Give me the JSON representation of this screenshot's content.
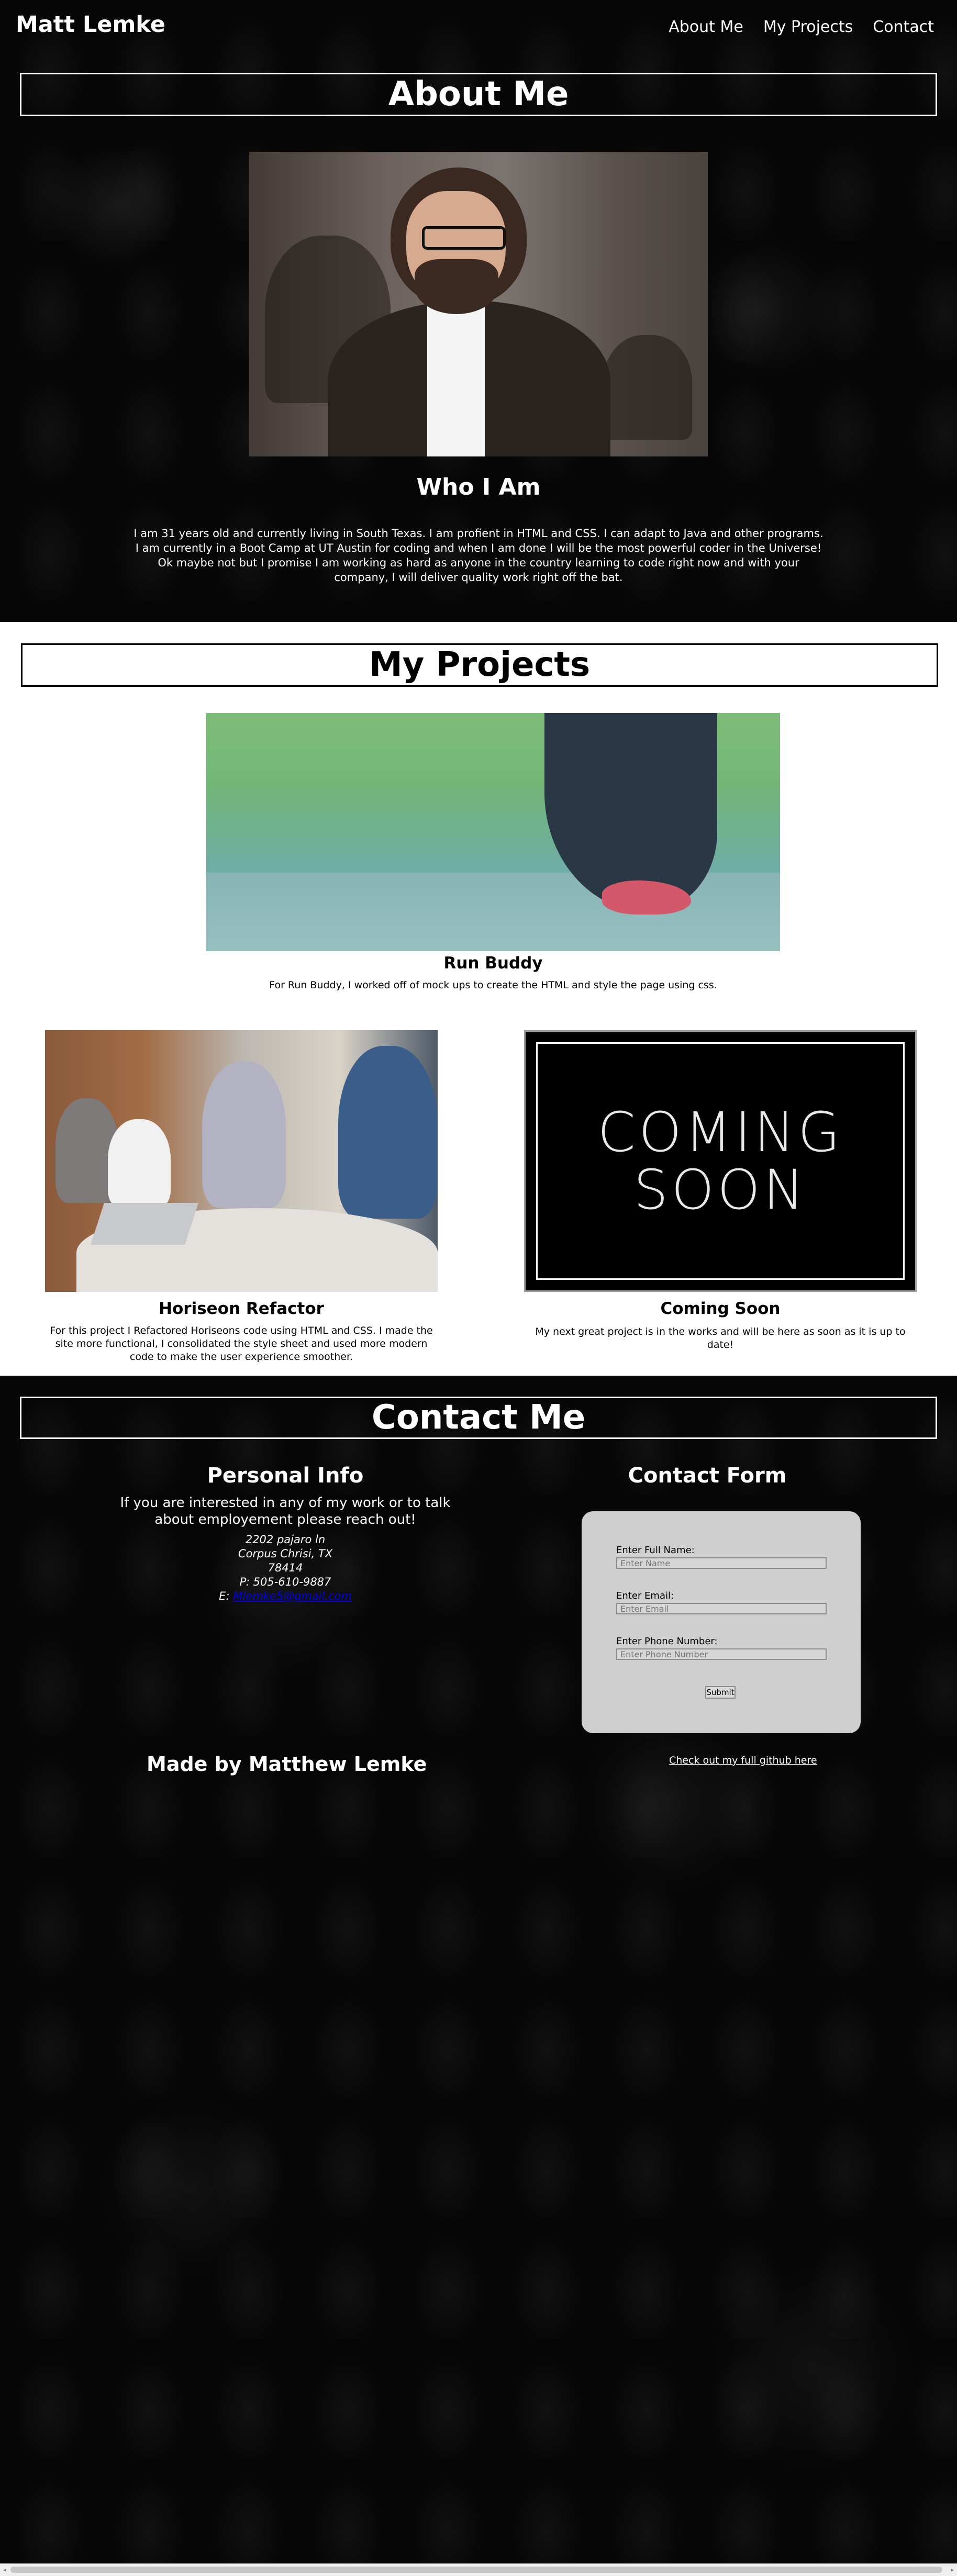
{
  "header": {
    "brand": "Matt Lemke",
    "nav": [
      "About Me",
      "My Projects",
      "Contact"
    ]
  },
  "about": {
    "title": "About Me",
    "photo_alt": "profile photo",
    "who_title": "Who I Am",
    "who_text": "I am 31 years old and currently living in South Texas. I am profient in HTML and CSS. I can adapt to Java and other programs. I am currently in a Boot Camp at UT Austin for coding and when I am done I will be the most powerful coder in the Universe! Ok maybe not but I promise I am working as hard as anyone in the country learning to code right now and with your company, I will deliver quality work right off the bat."
  },
  "projects": {
    "title": "My Projects",
    "run_buddy": {
      "title": "Run Buddy",
      "text": "For Run Buddy, I worked off of mock ups to create the HTML and style the page using css."
    },
    "horiseon": {
      "title": "Horiseon Refactor",
      "text": "For this project I Refactored Horiseons code using HTML and CSS. I made the site more functional, I consolidated the style sheet and used more modern code to make the user experience smoother."
    },
    "coming_soon": {
      "title": "Coming Soon",
      "image_text": [
        "COMING",
        "SOON"
      ],
      "text": "My next great project is in the works and will be here as soon as it is up to date!"
    }
  },
  "contact": {
    "title": "Contact Me",
    "personal_info": {
      "title": "Personal Info",
      "intro": "If you are interested in any of my work or to talk about employement please reach out!",
      "address_line1": "2202 pajaro ln",
      "address_line2": "Corpus Chrisi, TX",
      "address_line3": "78414",
      "phone": "P: 505-610-9887",
      "email_prefix": "E: ",
      "email": "Mlemke5@gmail.com"
    },
    "form": {
      "title": "Contact Form",
      "name_label": "Enter Full Name:",
      "name_placeholder": "Enter Name",
      "email_label": "Enter Email:",
      "email_placeholder": "Enter Email",
      "phone_label": "Enter Phone Number:",
      "phone_placeholder": "Enter Phone Number",
      "submit": "Submit"
    },
    "github_link": "Check out my full github here",
    "made_by": "Made by Matthew Lemke"
  }
}
